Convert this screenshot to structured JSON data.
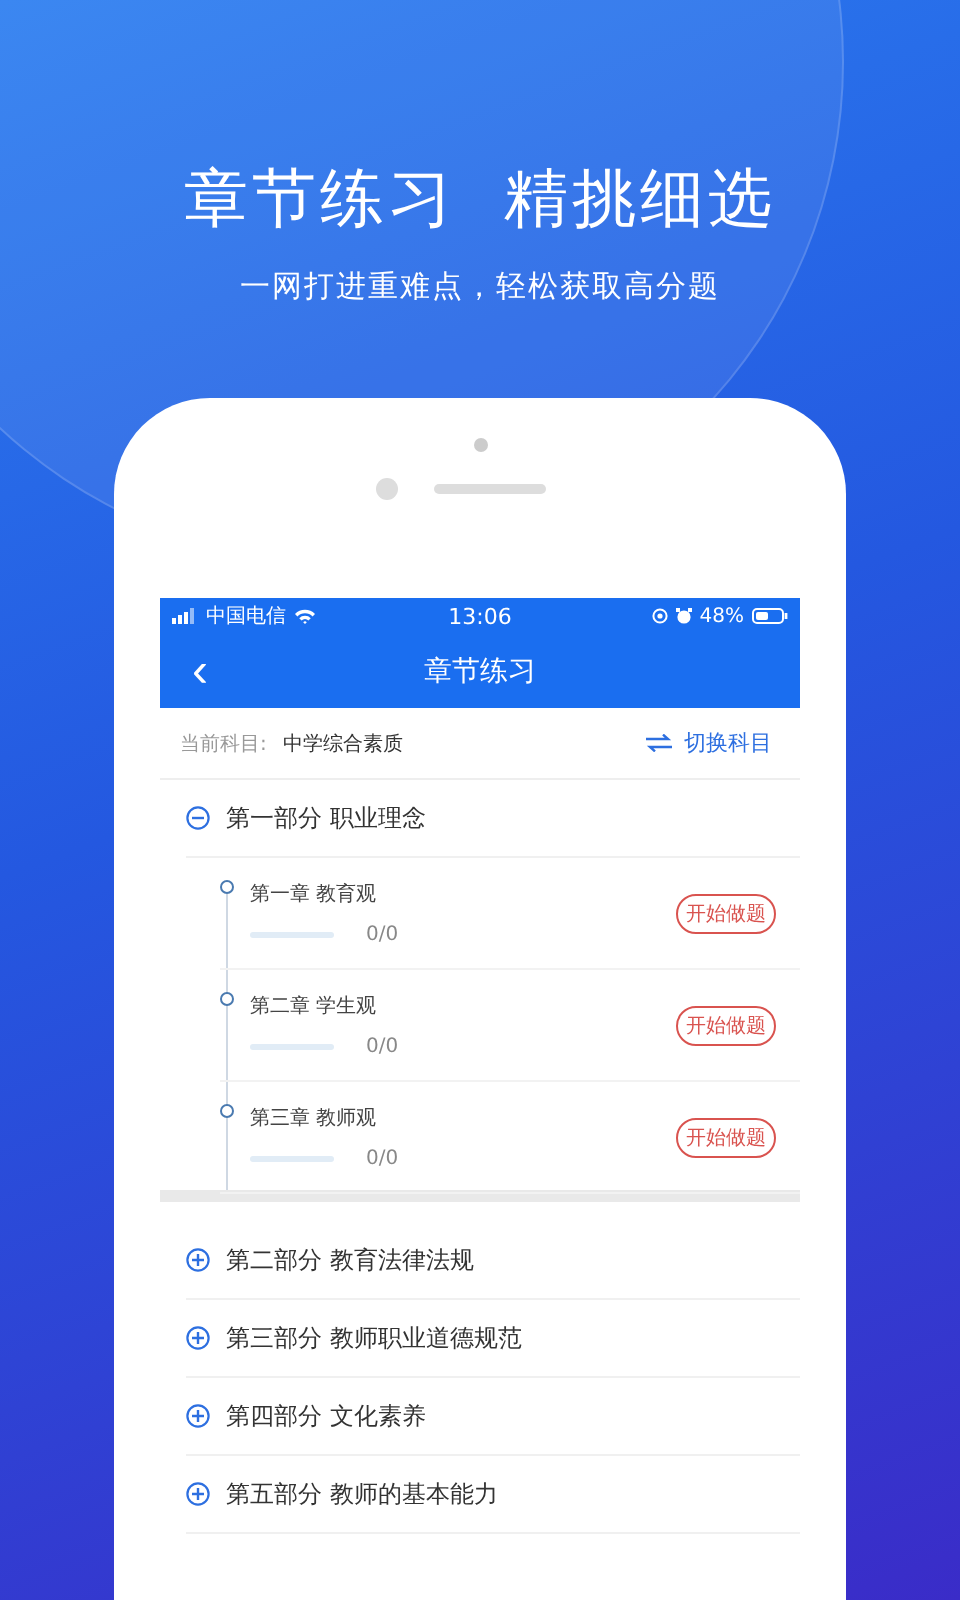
{
  "promo": {
    "headline": "章节练习  精挑细选",
    "subline": "一网打进重难点，轻松获取高分题"
  },
  "status_bar": {
    "carrier": "中国电信",
    "time": "13:06",
    "battery": "48%"
  },
  "nav": {
    "back": "‹",
    "title": "章节练习"
  },
  "subject": {
    "label": "当前科目:",
    "value": "中学综合素质",
    "switch": "切换科目"
  },
  "parts": [
    {
      "title": "第一部分 职业理念",
      "expanded": true,
      "chapters": [
        {
          "title": "第一章 教育观",
          "level": 0,
          "progress": "0/0",
          "action": "开始做题"
        },
        {
          "title": "第二章 学生观",
          "level": 0,
          "progress": "0/0",
          "action": "开始做题"
        },
        {
          "title": "第三章 教师观",
          "level": 0,
          "progress": "0/0",
          "action": "开始做题"
        }
      ]
    },
    {
      "title": "第二部分 教育法律法规",
      "expanded": false
    },
    {
      "title": "第三部分 教师职业道德规范",
      "expanded": false
    },
    {
      "title": "第四部分 文化素养",
      "expanded": false
    },
    {
      "title": "第五部分 教师的基本能力",
      "expanded": false
    }
  ]
}
